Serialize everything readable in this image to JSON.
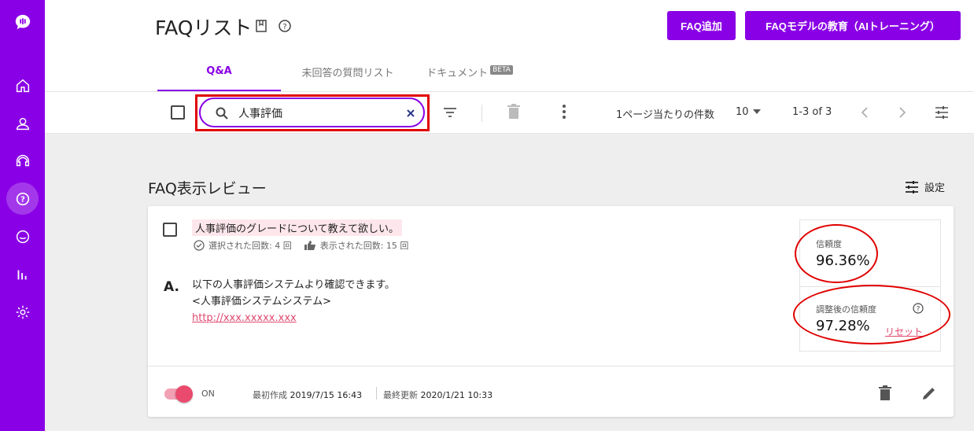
{
  "header": {
    "title": "FAQリスト",
    "add_button": "FAQ追加",
    "train_button": "FAQモデルの教育（AIトレーニング）"
  },
  "tabs": [
    {
      "label": "Q&A"
    },
    {
      "label": "未回答の質問リスト"
    },
    {
      "label": "ドキュメント",
      "badge": "BETA"
    }
  ],
  "toolbar": {
    "search_value": "人事評価",
    "per_page_label": "1ページ当たりの件数",
    "per_page_value": "10",
    "range": "1-3 of 3"
  },
  "main": {
    "section_title": "FAQ表示レビュー",
    "settings_label": "設定"
  },
  "card": {
    "question": "人事評価のグレードについて教えて欲しい。",
    "selected_count": "選択された回数: 4 回",
    "shown_count": "表示された回数: 15 回",
    "answer_marker": "A.",
    "answer_line1": "以下の人事評価システムより確認できます。",
    "answer_line2": "<人事評価システムシステム>",
    "answer_link": "http://xxx.xxxxx.xxx",
    "confidence_label": "信頼度",
    "confidence_value": "96.36%",
    "adjusted_label": "調整後の信頼度",
    "adjusted_value": "97.28%",
    "reset_label": "リセット",
    "toggle_label": "ON",
    "created_label": "最初作成",
    "created_value": "2019/7/15 16:43",
    "updated_label": "最終更新",
    "updated_value": "2020/1/21 10:33"
  },
  "colors": {
    "accent": "#8a00e6",
    "highlight": "#e00000",
    "pink": "#e94a6e"
  }
}
